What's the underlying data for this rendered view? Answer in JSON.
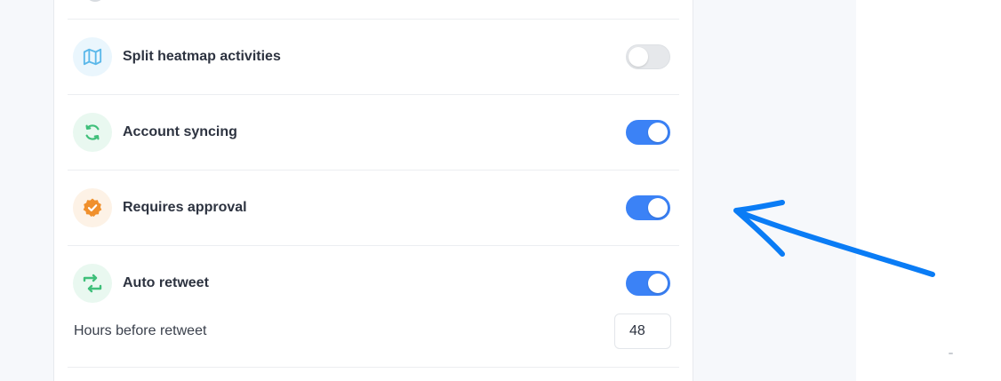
{
  "settings": {
    "rows": [
      {
        "label": "Split heatmap activities",
        "icon": "map-icon",
        "enabled": false,
        "icon_bg": "#eaf6fd",
        "icon_color": "#5bb8ea"
      },
      {
        "label": "Account syncing",
        "icon": "sync-icon",
        "enabled": true,
        "icon_bg": "#e9f8f0",
        "icon_color": "#3fbf7a"
      },
      {
        "label": "Requires approval",
        "icon": "verified-badge-icon",
        "enabled": true,
        "icon_bg": "#fdf2e6",
        "icon_color": "#f0902c"
      },
      {
        "label": "Auto retweet",
        "icon": "retweet-icon",
        "enabled": true,
        "icon_bg": "#e9f8f0",
        "icon_color": "#3fbf7a"
      }
    ],
    "hours_before_retweet": {
      "label": "Hours before retweet",
      "value": "48"
    }
  },
  "colors": {
    "toggle_on": "#3b82f6",
    "toggle_off": "#e6e8eb",
    "annotation_arrow": "#0a7cf5"
  }
}
